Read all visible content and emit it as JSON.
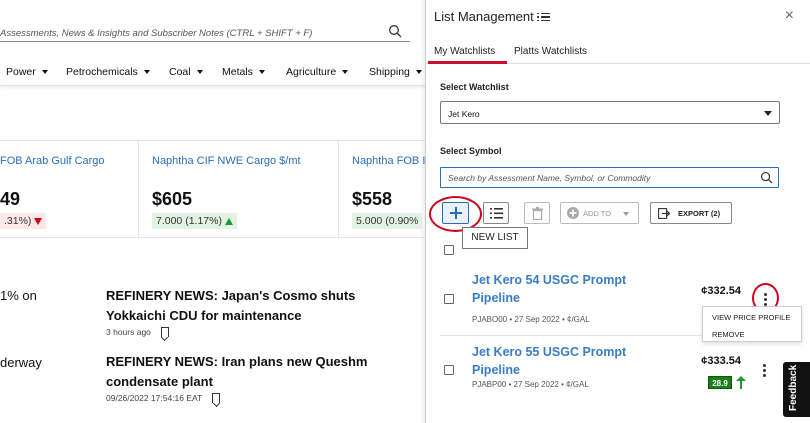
{
  "search": {
    "placeholder": "Assessments, News & Insights and Subscriber Notes (CTRL + SHIFT + F)"
  },
  "nav": {
    "items": [
      "Power",
      "Petrochemicals",
      "Coal",
      "Metals",
      "Agriculture",
      "Shipping"
    ]
  },
  "quotes": [
    {
      "name": "FOB Arab Gulf Cargo",
      "price": "49",
      "change": ".31%)",
      "direction": "down"
    },
    {
      "name": "Naphtha CIF NWE Cargo $/mt",
      "price": "$605",
      "change": "7.000 (1.17%)",
      "direction": "up"
    },
    {
      "name": "Naphtha FOB I",
      "price": "$558",
      "change": "5.000 (0.90%",
      "direction": "up"
    }
  ],
  "news": [
    {
      "fragment": "1% on",
      "headline": "REFINERY NEWS: Japan's Cosmo shuts Yokkaichi CDU for maintenance",
      "time": "3 hours ago"
    },
    {
      "fragment": "derway",
      "headline": "REFINERY NEWS: Iran plans new Queshm condensate plant",
      "time": "09/26/2022 17:54:16 EAT"
    }
  ],
  "panel": {
    "title": "List Management",
    "close": "×",
    "tabs": [
      "My Watchlists",
      "Platts Watchlists"
    ],
    "select_watchlist_label": "Select Watchlist",
    "watchlist_value": "Jet Kero",
    "select_symbol_label": "Select Symbol",
    "symbol_search_placeholder": "Search by Assessment Name, Symbol, or Commodity",
    "toolbar": {
      "add_to": "ADD TO",
      "export": "EXPORT (2)",
      "tooltip": "NEW LIST"
    },
    "symbols": [
      {
        "name": "Jet Kero 54 USGC Prompt Pipeline",
        "meta": "PJABO00 • 27 Sep 2022 • ¢/GAL",
        "price": "¢332.54"
      },
      {
        "name": "Jet Kero 55 USGC Prompt Pipeline",
        "meta": "PJABP00 • 27 Sep 2022 • ¢/GAL",
        "price": "¢333.54",
        "badge": "28.9"
      }
    ],
    "row_menu": [
      "VIEW PRICE PROFILE",
      "REMOVE"
    ]
  },
  "feedback": "Feedback",
  "colors": {
    "link_blue": "#2a6ebb",
    "brand_red": "#c8102e",
    "up_green": "#1e9a2e",
    "down_red": "#d0021b"
  }
}
